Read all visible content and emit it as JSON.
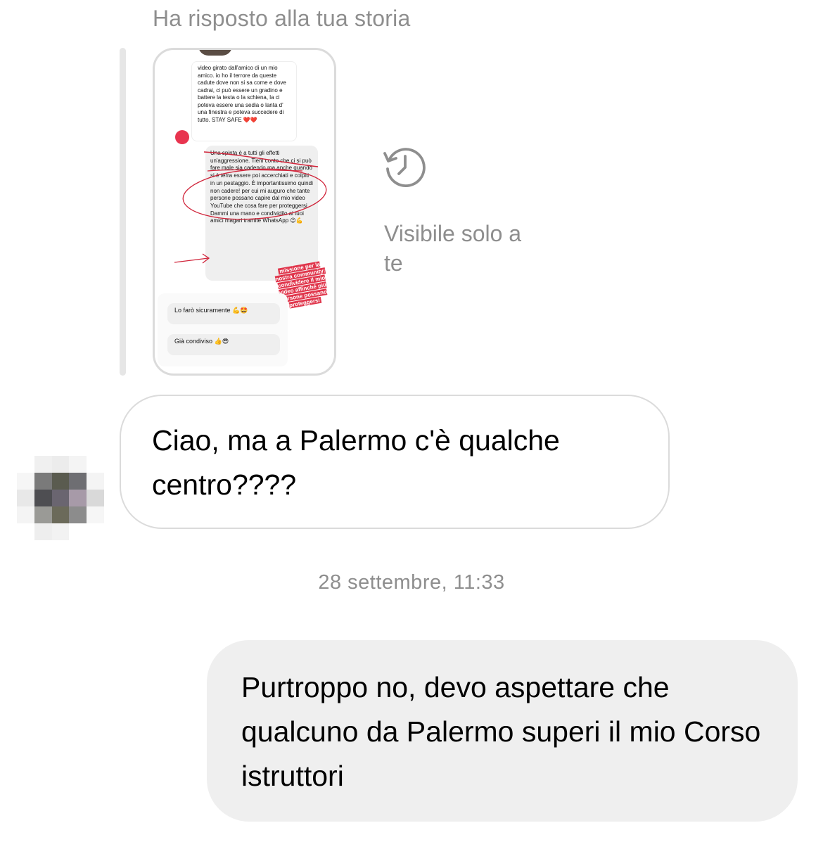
{
  "story_reply": {
    "header": "Ha risposto alla tua storia",
    "visibility_note": "Visibile solo a te",
    "thumbnail": {
      "bubble1_text": "video girato dall'amico di un mio amico. io ho il terrore da queste cadute dove non si sa come e dove cadrai, ci può essere un gradino e battere la testa o la schiena, la ci poteva essere una sedia o lanta d' una finestra e poteva succedere di tutto. STAY SAFE ❤️❤️",
      "bubble2_text": "Una spinta è a tutti gli effetti un'aggressione. Tieni conto che ci si può fare male sia cadendo ma anche quando si è terra essere poi accerchiati e colpiti in un pestaggio. È importantissimo quindi non cadere! per cui mi auguro che tante persone possano capire dal mio video YouTube che cosa fare per proteggersi. Dammi una mano e condividilo ai tuoi amici magari tramite WhatsApp 😉💪",
      "sticker_text": "missione per la nostra community: condividere il mio video affinché più persone possano proteggersi",
      "poll_option_1": "Lo farò sicuramente 💪🤩",
      "poll_option_2": "Già condiviso 👍😎"
    }
  },
  "messages": {
    "incoming_text": "Ciao, ma a Palermo c'è qualche centro????",
    "timestamp": "28 settembre, 11:33",
    "outgoing_text": "Purtroppo no, devo aspettare che qualcuno da Palermo superi il mio Corso istruttori"
  },
  "colors": {
    "secondary_text": "#8e8e8e",
    "bubble_border": "#dbdbdb",
    "outgoing_bubble": "#efefef",
    "annotation_red": "#e0364c"
  },
  "icons": {
    "visibility": "history-clock-icon",
    "sender_avatar": "pixelated-avatar"
  }
}
